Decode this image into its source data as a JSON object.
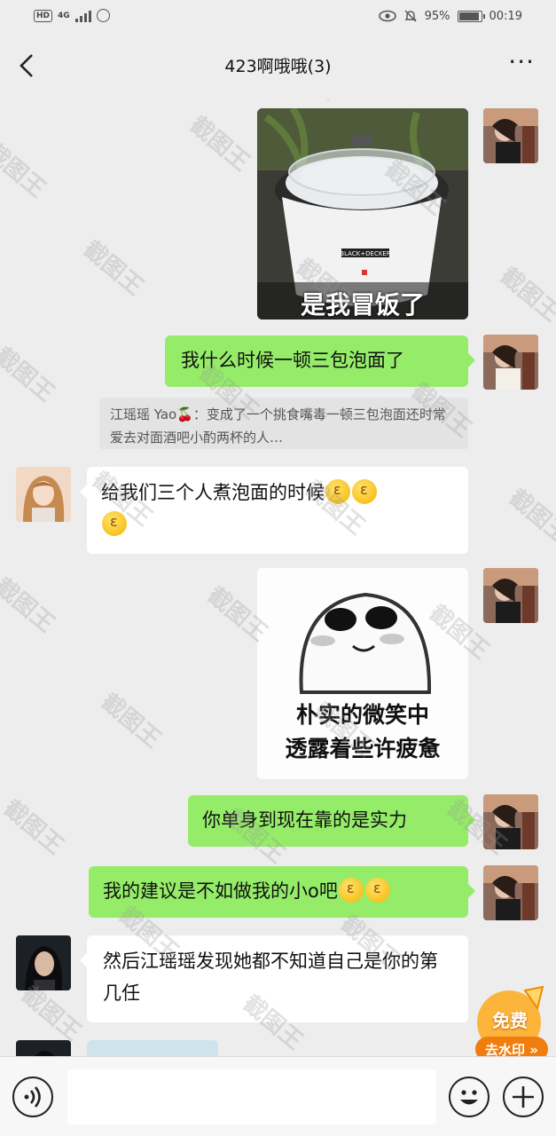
{
  "status_bar": {
    "hd": "HD",
    "network": "4G",
    "battery_percent": "95%",
    "battery_level": 0.95,
    "time": "00:19"
  },
  "header": {
    "title": "423啊哦哦(3)",
    "more": "···"
  },
  "messages": {
    "m1_image_caption": "是我冒饭了",
    "m2_text": "我什么时候一顿三包泡面了",
    "m3_quote": "江瑶瑶 Yao🍒：变成了一个挑食嘴毒一顿三包泡面还时常爱去对面酒吧小酌两杯的人…",
    "m4_text": "给我们三个人煮泡面的时候",
    "m5_image_caption_line1": "朴实的微笑中",
    "m5_image_caption_line2": "透露着些许疲惫",
    "m6_text": "你单身到现在靠的是实力",
    "m7_text": "我的建议是不如做我的小o吧",
    "m8_text": "然后江瑶瑶发现她都不知道自己是你的第几任"
  },
  "brands": {
    "rice_cooker": "BLACK+DECKER"
  },
  "watermark": {
    "text": "截图王"
  },
  "badge": {
    "line1": "免费",
    "line2": "去水印 »"
  },
  "colors": {
    "background": "#ededed",
    "bubble_sent": "#95ec69",
    "bubble_received": "#ffffff",
    "badge_orange": "#f39a1e"
  },
  "icons": {
    "back": "chevron-left-icon",
    "more": "more-dots-icon",
    "voice": "voice-icon",
    "emoji": "emoji-icon",
    "add": "add-icon"
  }
}
